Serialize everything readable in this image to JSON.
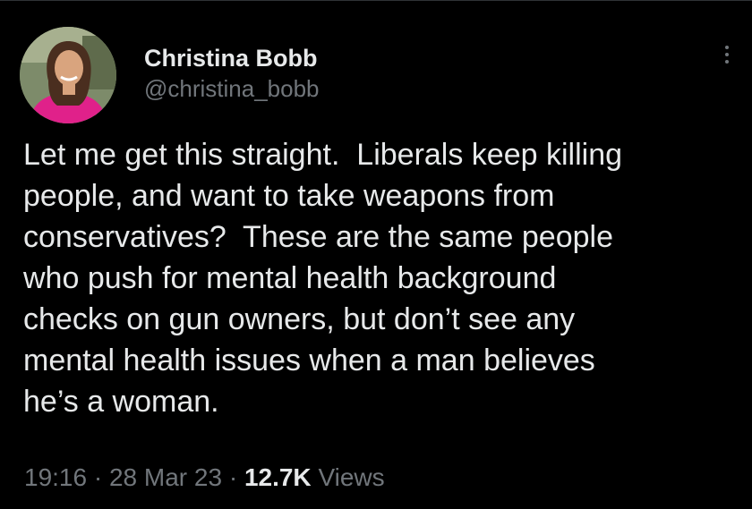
{
  "author": {
    "display_name": "Christina Bobb",
    "handle": "@christina_bobb",
    "avatar_icon": "profile-photo"
  },
  "tweet": {
    "text": "Let me get this straight.  Liberals keep killing\npeople, and want to take weapons from\nconservatives?  These are the same people\nwho push for mental health background\nchecks on gun owners, but don’t see any\nmental health issues when a man believes\nhe’s a woman."
  },
  "meta": {
    "time": "19:16",
    "separator": "·",
    "date": "28 Mar 23",
    "views_count": "12.7K",
    "views_label": "Views"
  },
  "colors": {
    "background": "#000000",
    "primary_text": "#e7e9ea",
    "secondary_text": "#71767b"
  },
  "icons": {
    "more": "more-vertical-icon"
  }
}
